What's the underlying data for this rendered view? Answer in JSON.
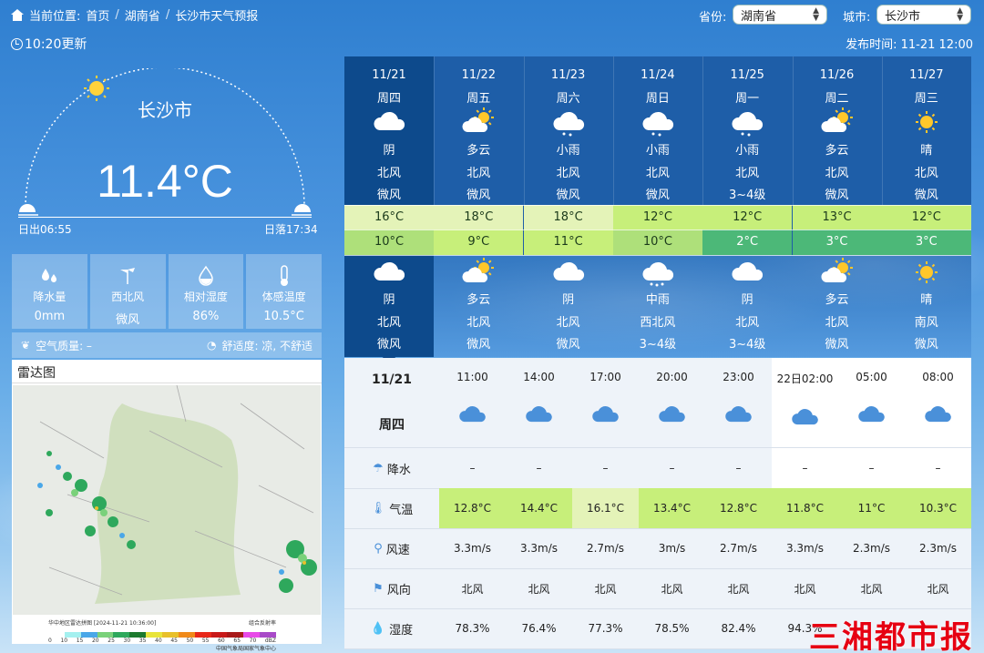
{
  "breadcrumb": {
    "prefix": "当前位置:",
    "home": "首页",
    "sep": "/",
    "province": "湖南省",
    "page": "长沙市天气预报"
  },
  "selectors": {
    "province_label": "省份:",
    "province_value": "湖南省",
    "city_label": "城市:",
    "city_value": "长沙市"
  },
  "update_time": "10:20更新",
  "publish_time": "发布时间: 11-21 12:00",
  "current": {
    "city": "长沙市",
    "temperature": "11.4°C",
    "sunrise": "日出06:55",
    "sunset": "日落17:34",
    "tiles": [
      {
        "icon": "raindrops-icon",
        "label": "降水量",
        "value": "0mm"
      },
      {
        "icon": "wind-vane-icon",
        "label": "西北风",
        "value": "微风"
      },
      {
        "icon": "humidity-drop-icon",
        "label": "相对湿度",
        "value": "86%"
      },
      {
        "icon": "thermometer-icon",
        "label": "体感温度",
        "value": "10.5°C"
      }
    ],
    "air_quality": "空气质量: –",
    "comfort": "舒适度: 凉, 不舒适"
  },
  "radar": {
    "title": "雷达图",
    "map_title": "华中地区雷达拼图 [2024-11-21 10:36:00]",
    "map_legend_note": "组合反射率",
    "legend_values": [
      "0",
      "10",
      "15",
      "20",
      "25",
      "30",
      "35",
      "40",
      "45",
      "50",
      "55",
      "60",
      "65",
      "70",
      "dBZ"
    ],
    "map_source": "中国气象局国家气象中心"
  },
  "forecast": [
    {
      "date": "11/21",
      "weekday": "周四",
      "day_icon": "cloudy-icon",
      "day_weather": "阴",
      "day_dir": "北风",
      "day_level": "微风",
      "high": "16°C",
      "low": "10°C",
      "night_icon": "cloudy-icon",
      "night_weather": "阴",
      "night_dir": "北风",
      "night_level": "微风",
      "hi_color": "#e4f3b8",
      "lo_color": "#aee07a"
    },
    {
      "date": "11/22",
      "weekday": "周五",
      "day_icon": "partly-cloudy-icon",
      "day_weather": "多云",
      "day_dir": "北风",
      "day_level": "微风",
      "high": "18°C",
      "low": "9°C",
      "night_icon": "partly-cloudy-icon",
      "night_weather": "多云",
      "night_dir": "北风",
      "night_level": "微风",
      "hi_color": "#e4f3b8",
      "lo_color": "#c7ef7a"
    },
    {
      "date": "11/23",
      "weekday": "周六",
      "day_icon": "light-rain-icon",
      "day_weather": "小雨",
      "day_dir": "北风",
      "day_level": "微风",
      "high": "18°C",
      "low": "11°C",
      "night_icon": "cloudy-icon",
      "night_weather": "阴",
      "night_dir": "北风",
      "night_level": "微风",
      "hi_color": "#e4f3b8",
      "lo_color": "#c7ef7a"
    },
    {
      "date": "11/24",
      "weekday": "周日",
      "day_icon": "light-rain-icon",
      "day_weather": "小雨",
      "day_dir": "北风",
      "day_level": "微风",
      "high": "12°C",
      "low": "10°C",
      "night_icon": "moderate-rain-icon",
      "night_weather": "中雨",
      "night_dir": "西北风",
      "night_level": "3~4级",
      "hi_color": "#c7ef7a",
      "lo_color": "#aee07a"
    },
    {
      "date": "11/25",
      "weekday": "周一",
      "day_icon": "light-rain-icon",
      "day_weather": "小雨",
      "day_dir": "北风",
      "day_level": "3~4级",
      "high": "12°C",
      "low": "2°C",
      "night_icon": "cloudy-icon",
      "night_weather": "阴",
      "night_dir": "北风",
      "night_level": "3~4级",
      "hi_color": "#c7ef7a",
      "lo_color": "#4cb878"
    },
    {
      "date": "11/26",
      "weekday": "周二",
      "day_icon": "partly-cloudy-icon",
      "day_weather": "多云",
      "day_dir": "北风",
      "day_level": "微风",
      "high": "13°C",
      "low": "3°C",
      "night_icon": "partly-cloudy-icon",
      "night_weather": "多云",
      "night_dir": "北风",
      "night_level": "微风",
      "hi_color": "#c7ef7a",
      "lo_color": "#4cb878"
    },
    {
      "date": "11/27",
      "weekday": "周三",
      "day_icon": "sunny-icon",
      "day_weather": "晴",
      "day_dir": "北风",
      "day_level": "微风",
      "high": "12°C",
      "low": "3°C",
      "night_icon": "sunny-icon",
      "night_weather": "晴",
      "night_dir": "南风",
      "night_level": "微风",
      "hi_color": "#c7ef7a",
      "lo_color": "#4cb878"
    }
  ],
  "hourly": {
    "date": "11/21",
    "weekday": "周四",
    "times": [
      "11:00",
      "14:00",
      "17:00",
      "20:00",
      "23:00",
      "22日02:00",
      "05:00",
      "08:00"
    ],
    "labels": {
      "precip": "降水",
      "temp": "气温",
      "speed": "风速",
      "dir": "风向",
      "humidity": "湿度"
    },
    "precip": [
      "–",
      "–",
      "–",
      "–",
      "–",
      "–",
      "–",
      "–"
    ],
    "temps": [
      "12.8°C",
      "14.4°C",
      "16.1°C",
      "13.4°C",
      "12.8°C",
      "11.8°C",
      "11°C",
      "10.3°C"
    ],
    "temp_colors": [
      "#c7ef7a",
      "#c7ef7a",
      "#e4f3b8",
      "#c7ef7a",
      "#c7ef7a",
      "#c7ef7a",
      "#c7ef7a",
      "#c7ef7a"
    ],
    "speeds": [
      "3.3m/s",
      "3.3m/s",
      "2.7m/s",
      "3m/s",
      "2.7m/s",
      "3.3m/s",
      "2.3m/s",
      "2.3m/s"
    ],
    "dirs": [
      "北风",
      "北风",
      "北风",
      "北风",
      "北风",
      "北风",
      "北风",
      "北风"
    ],
    "humidity": [
      "78.3%",
      "76.4%",
      "77.3%",
      "78.5%",
      "82.4%",
      "94.3%",
      "",
      ""
    ]
  },
  "watermark": "三湘都市报"
}
